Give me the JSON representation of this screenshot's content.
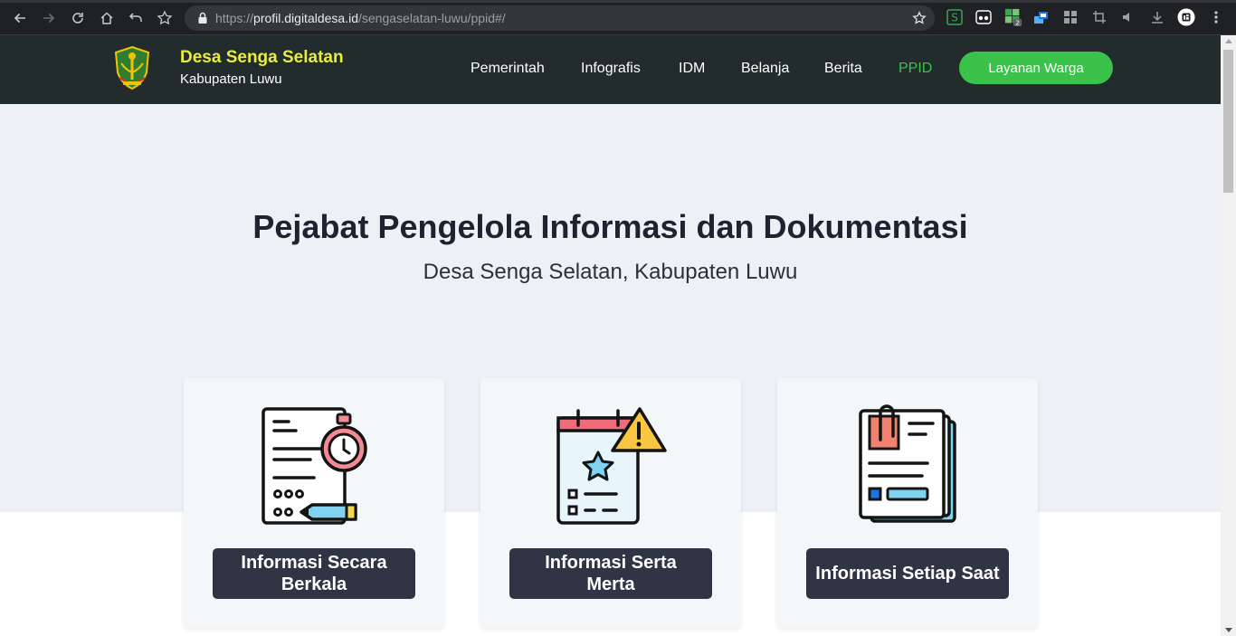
{
  "browser": {
    "url_scheme": "https://",
    "url_host": "profil.digitaldesa.id",
    "url_path": "/sengaselatan-luwu/ppid#/",
    "extensions": [
      "back-icon",
      "forward-icon",
      "reload-icon",
      "home-icon",
      "undo-icon",
      "bookmark-icon",
      "lock-icon",
      "star-icon",
      "extension-s-icon",
      "extension-glasses-icon",
      "extension-grid-icon",
      "extension-cube-icon",
      "extension-apps-icon",
      "crop-icon",
      "mute-icon",
      "download-icon",
      "profile-icon",
      "menu-icon"
    ],
    "extension_badge": "2"
  },
  "header": {
    "brand_name": "Desa Senga Selatan",
    "brand_sub": "Kabupaten Luwu",
    "nav": [
      {
        "label": "Pemerintah"
      },
      {
        "label": "Infografis"
      },
      {
        "label": "IDM"
      },
      {
        "label": "Belanja"
      },
      {
        "label": "Berita"
      },
      {
        "label": "PPID"
      }
    ],
    "active_nav": "PPID",
    "cta_label": "Layanan Warga"
  },
  "hero": {
    "title": "Pejabat Pengelola Informasi dan Dokumentasi",
    "subtitle": "Desa Senga Selatan, Kabupaten Luwu"
  },
  "cards": [
    {
      "label": "Informasi Secara Berkala",
      "icon": "document-stopwatch-icon"
    },
    {
      "label": "Informasi Serta Merta",
      "icon": "calendar-warning-icon"
    },
    {
      "label": "Informasi Setiap Saat",
      "icon": "documents-clip-icon"
    }
  ],
  "colors": {
    "header_bg": "#222c2d",
    "brand_yellow": "#e9ee3a",
    "accent_green": "#3bc24a",
    "hero_bg": "#edf1f5",
    "card_button": "#2f3545"
  }
}
